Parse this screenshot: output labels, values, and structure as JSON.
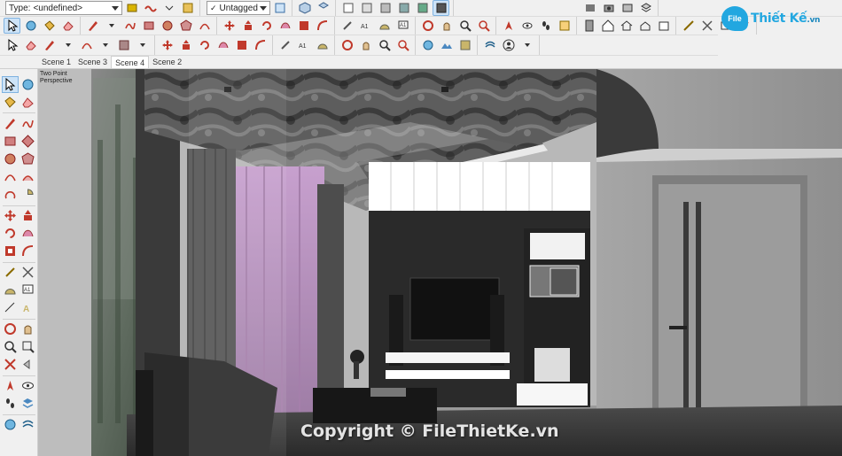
{
  "toolbar": {
    "type_label": "Type:",
    "type_value": "<undefined>",
    "tag_value": "Untagged"
  },
  "logo": {
    "mark": "File",
    "name": "Thiết Kế",
    "suffix": ".vn"
  },
  "scenes": {
    "tabs": [
      "Scene 1",
      "Scene 3",
      "Scene 4",
      "Scene 2"
    ],
    "active": "Scene 4"
  },
  "viewport": {
    "camera_label_1": "Two Point",
    "camera_label_2": "Perspective"
  },
  "watermark": "Copyright © FileThietKe.vn",
  "colors": {
    "accent": "#22a7e0",
    "toolbar_bg": "#f0f0f0",
    "active_tool": "#cde3f7",
    "curtain_pink": "#c9a3cf",
    "cabinet_white": "#ffffff",
    "tv_wall": "#2a2a2a"
  }
}
